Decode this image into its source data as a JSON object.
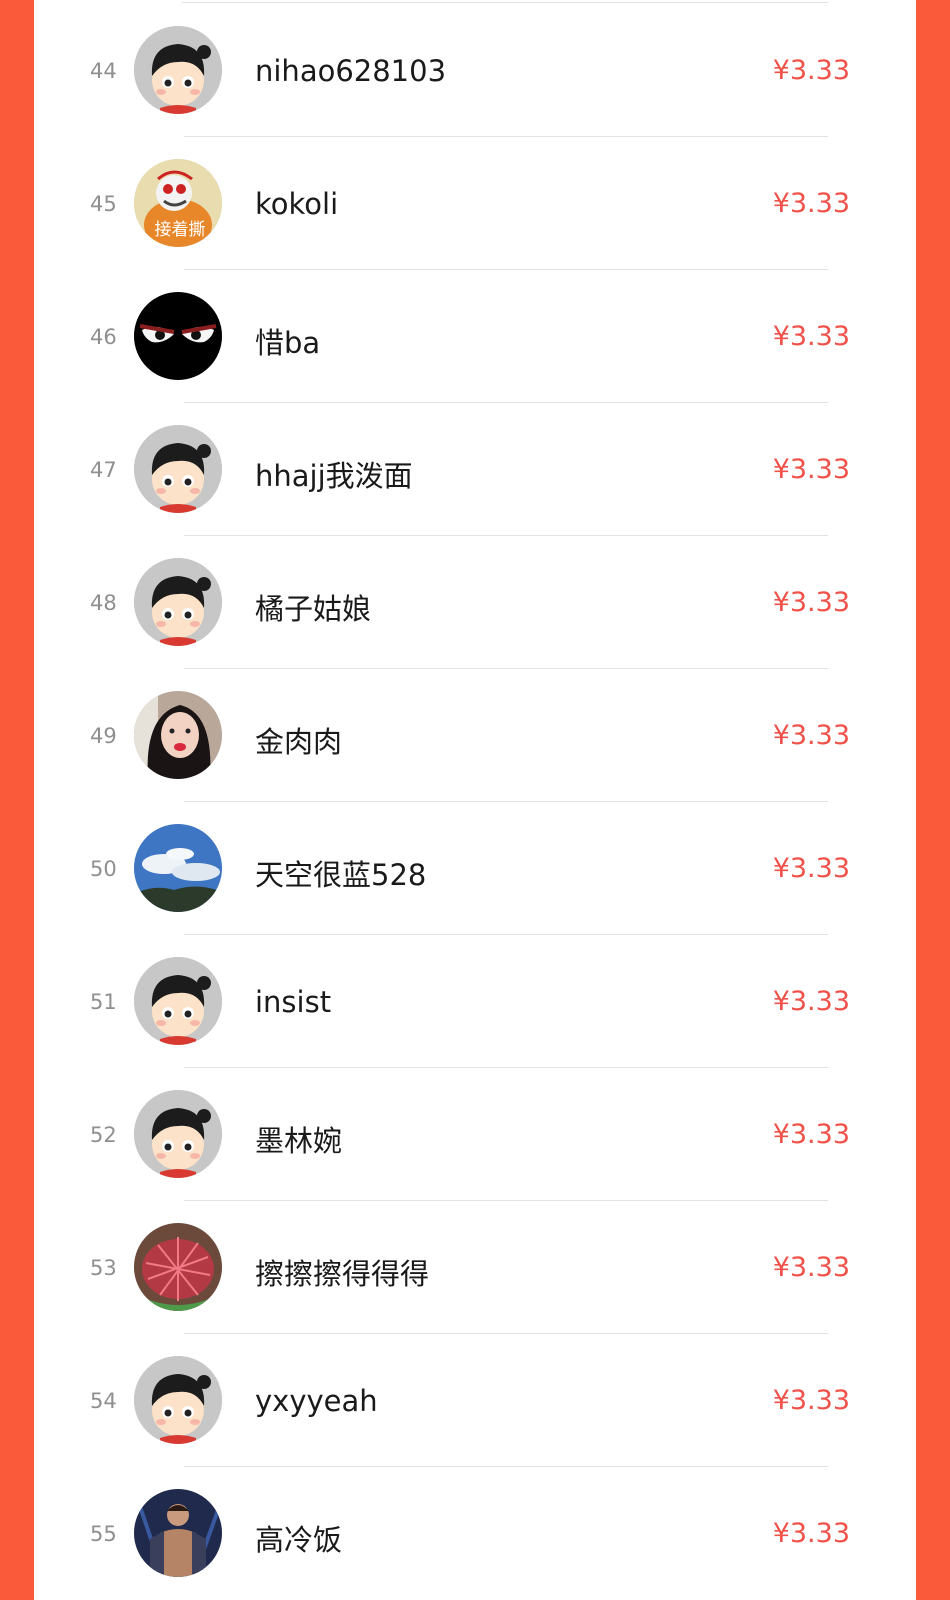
{
  "rows": [
    {
      "rank": "44",
      "name": "nihao628103",
      "amount": "¥3.33",
      "avatar_icon": "cartoon-avatar-icon"
    },
    {
      "rank": "45",
      "name": "kokoli",
      "amount": "¥3.33",
      "avatar_icon": "cartoon-monkey-avatar-icon",
      "avatar_text": "接着撕"
    },
    {
      "rank": "46",
      "name": "惜ba",
      "amount": "¥3.33",
      "avatar_icon": "dark-eyes-avatar-icon"
    },
    {
      "rank": "47",
      "name": "hhajj我泼面",
      "amount": "¥3.33",
      "avatar_icon": "cartoon-avatar-icon"
    },
    {
      "rank": "48",
      "name": "橘子姑娘",
      "amount": "¥3.33",
      "avatar_icon": "cartoon-avatar-icon"
    },
    {
      "rank": "49",
      "name": "金肉肉",
      "amount": "¥3.33",
      "avatar_icon": "photo-girl-avatar-icon"
    },
    {
      "rank": "50",
      "name": "天空很蓝528",
      "amount": "¥3.33",
      "avatar_icon": "sky-photo-avatar-icon"
    },
    {
      "rank": "51",
      "name": "insist",
      "amount": "¥3.33",
      "avatar_icon": "cartoon-avatar-icon"
    },
    {
      "rank": "52",
      "name": "墨林婉",
      "amount": "¥3.33",
      "avatar_icon": "cartoon-avatar-icon"
    },
    {
      "rank": "53",
      "name": "擦擦擦得得得",
      "amount": "¥3.33",
      "avatar_icon": "cactus-photo-avatar-icon"
    },
    {
      "rank": "54",
      "name": "yxyyeah",
      "amount": "¥3.33",
      "avatar_icon": "cartoon-avatar-icon"
    },
    {
      "rank": "55",
      "name": "高冷饭",
      "amount": "¥3.33",
      "avatar_icon": "game-character-avatar-icon"
    }
  ],
  "colors": {
    "background": "#fa5a3a",
    "amount": "#f0524a",
    "rank": "#8f8f8f",
    "name": "#1a1a1a",
    "divider": "#e3e3e3"
  }
}
